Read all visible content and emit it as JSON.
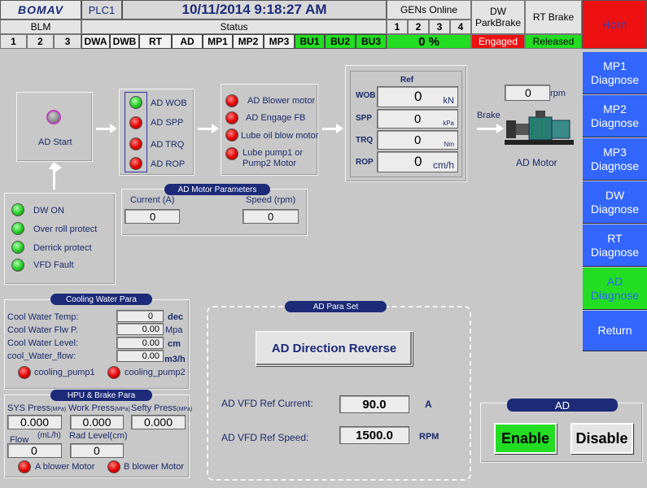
{
  "header": {
    "logo": "BOMAV",
    "plc": "PLC1",
    "datetime": "10/11/2014 9:18:27 AM",
    "gens_label": "GENs Online",
    "gens": [
      "1",
      "2",
      "3",
      "4"
    ],
    "gens_percent": "0 %",
    "dw_parkbrake_label": "DW ParkBrake",
    "dw_parkbrake_status": "Engaged",
    "rt_brake_label": "RT Brake",
    "rt_brake_status": "Released",
    "horn": "Horn",
    "blm_label": "BLM",
    "blm": [
      "1",
      "2",
      "3"
    ],
    "status_label": "Status",
    "status_tabs": [
      "DWA",
      "DWB",
      "RT",
      "AD",
      "MP1",
      "MP2",
      "MP3",
      "BU1",
      "BU2",
      "BU3"
    ]
  },
  "ad_start": {
    "label": "AD Start"
  },
  "ad_checks": [
    "AD  WOB",
    "AD  SPP",
    "AD  TRQ",
    "AD  ROP"
  ],
  "ad_motors": [
    "AD Blower motor",
    "AD Engage FB",
    "Lube oil blow motor",
    "Lube pump1 or\nPump2 Motor"
  ],
  "ref": {
    "title": "Ref",
    "rows": [
      {
        "label": "WOB",
        "value": "0",
        "unit": "kN"
      },
      {
        "label": "SPP",
        "value": "0",
        "unit": "kPa"
      },
      {
        "label": "TRQ",
        "value": "0",
        "unit": "Nm"
      },
      {
        "label": "ROP",
        "value": "0",
        "unit": "cm/h"
      }
    ]
  },
  "motor": {
    "rpm_value": "0",
    "rpm_unit": "rpm",
    "brake": "Brake",
    "name": "AD Motor"
  },
  "conditions": [
    "DW ON",
    "Over roll protect",
    "Derrick protect",
    "VFD Fault"
  ],
  "motor_params": {
    "title": "AD  Motor Parameters",
    "current_label": "Current (A)",
    "current_value": "0",
    "speed_label": "Speed (rpm)",
    "speed_value": "0"
  },
  "cooling": {
    "title": "Cooling Water Para",
    "rows": [
      {
        "label": "Cool Water Temp:",
        "value": "0",
        "unit": "dec"
      },
      {
        "label": "Cool Water Flw P.",
        "value": "0.00",
        "unit": "Mpa"
      },
      {
        "label": "Cool Water Level:",
        "value": "0.00",
        "unit": "cm"
      },
      {
        "label": "cool_Water_flow:",
        "value": "0.00",
        "unit": "m3/h"
      }
    ],
    "pump1": "cooling_pump1",
    "pump2": "cooling_pump2"
  },
  "hpu": {
    "title": "HPU & Brake Para",
    "sys_label": "SYS Press",
    "work_label": "Work Press",
    "sefty_label": "Sefty Press",
    "unit_small": "(MPa)",
    "sys_value": "0.000",
    "work_value": "0.000",
    "sefty_value": "0.000",
    "flow_label": "Flow",
    "flow_unit": "(mL/h)",
    "flow_value": "0",
    "rad_label": "Rad Level(cm)",
    "rad_value": "0",
    "blower_a": "A blower Motor",
    "blower_b": "B blower Motor"
  },
  "para_set": {
    "title": "AD  Para Set",
    "reverse_button": "AD Direction Reverse",
    "current_label": "AD VFD Ref Current:",
    "current_value": "90.0",
    "current_unit": "A",
    "speed_label": "AD VFD Ref Speed:",
    "speed_value": "1500.0",
    "speed_unit": "RPM"
  },
  "ad_control": {
    "title": "AD",
    "enable": "Enable",
    "disable": "Disable"
  },
  "nav": [
    "MP1\nDiagnose",
    "MP2\nDiagnose",
    "MP3\nDiagnose",
    "DW\nDiagnose",
    "RT\nDiagnose",
    "AD\nDiagnose",
    "Return"
  ]
}
